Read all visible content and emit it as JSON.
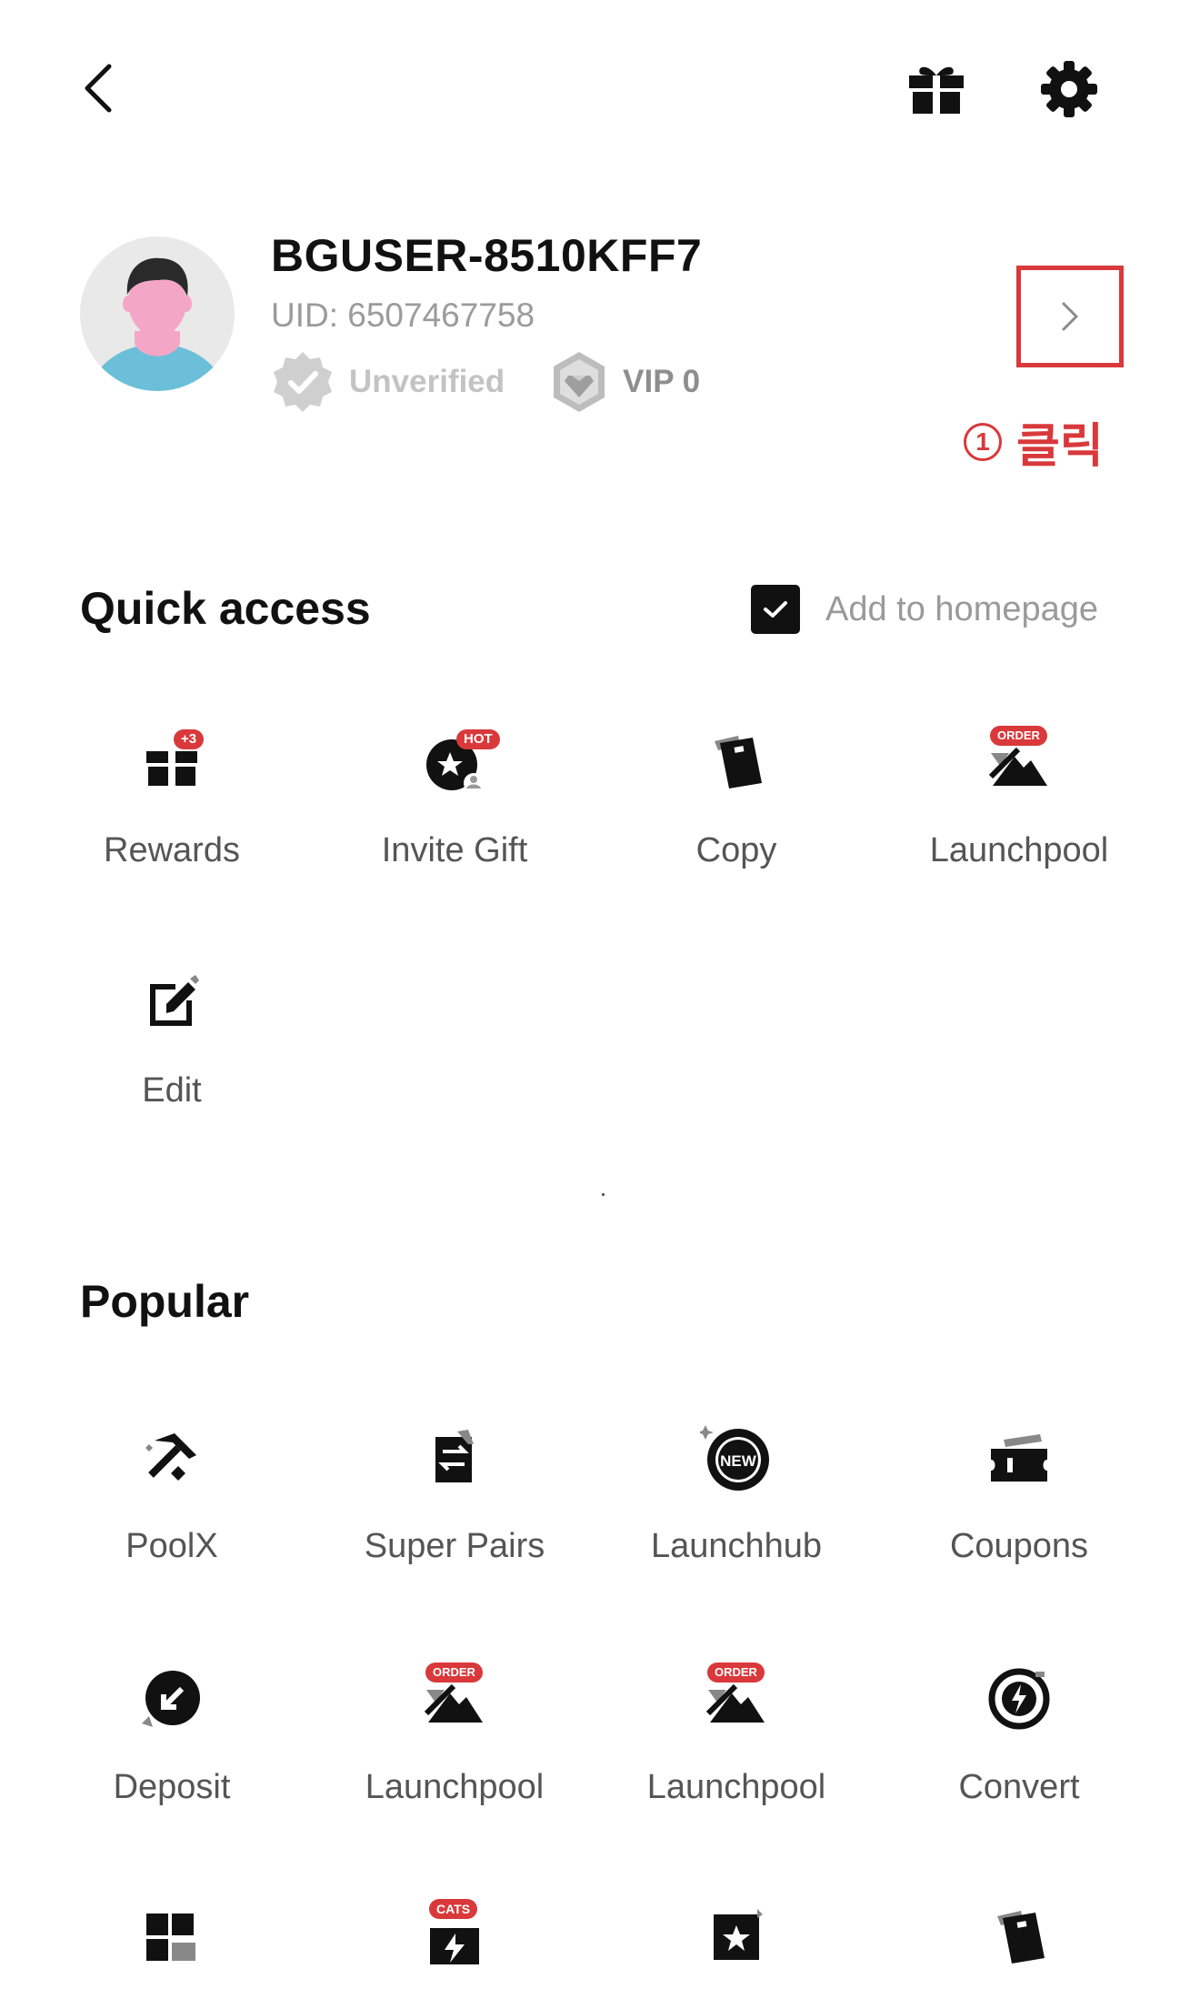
{
  "header": {
    "back_icon": "chevron-left-icon",
    "gift_icon": "gift-icon",
    "settings_icon": "gear-icon"
  },
  "profile": {
    "username": "BGUSER-8510KFF7",
    "uid": "UID: 6507467758",
    "verification_label": "Unverified",
    "vip_label": "VIP 0",
    "arrow_icon": "chevron-right-icon"
  },
  "annotation": {
    "number": "1",
    "text": "클릭",
    "color": "#d9393b"
  },
  "quick_access": {
    "title": "Quick access",
    "add_home_label": "Add to homepage",
    "add_home_checked": true,
    "items": [
      {
        "label": "Rewards",
        "icon": "rewards-icon",
        "badge": "+3"
      },
      {
        "label": "Invite Gift",
        "icon": "invite-gift-icon",
        "badge": "HOT"
      },
      {
        "label": "Copy",
        "icon": "copy-icon",
        "badge": ""
      },
      {
        "label": "Launchpool",
        "icon": "launchpool-icon",
        "badge": "ORDER"
      },
      {
        "label": "Edit",
        "icon": "edit-icon",
        "badge": ""
      }
    ]
  },
  "popular": {
    "title": "Popular",
    "items": [
      {
        "label": "PoolX",
        "icon": "poolx-icon",
        "badge": ""
      },
      {
        "label": "Super Pairs",
        "icon": "super-pairs-icon",
        "badge": ""
      },
      {
        "label": "Launchhub",
        "icon": "launchhub-icon",
        "badge": "NEW"
      },
      {
        "label": "Coupons",
        "icon": "coupons-icon",
        "badge": ""
      },
      {
        "label": "Deposit",
        "icon": "deposit-icon",
        "badge": ""
      },
      {
        "label": "Launchpool",
        "icon": "launchpool-icon",
        "badge": "ORDER"
      },
      {
        "label": "Launchpool",
        "icon": "launchpool-icon",
        "badge": "ORDER"
      },
      {
        "label": "Convert",
        "icon": "convert-icon",
        "badge": ""
      },
      {
        "label": "",
        "icon": "grid-icon",
        "badge": ""
      },
      {
        "label": "",
        "icon": "cats-icon",
        "badge": "CATS"
      },
      {
        "label": "",
        "icon": "star-card-icon",
        "badge": ""
      },
      {
        "label": "",
        "icon": "copy-icon",
        "badge": ""
      }
    ]
  },
  "colors": {
    "accent_red": "#d9393b",
    "text_primary": "#111111",
    "text_secondary": "#9b9b9b"
  }
}
